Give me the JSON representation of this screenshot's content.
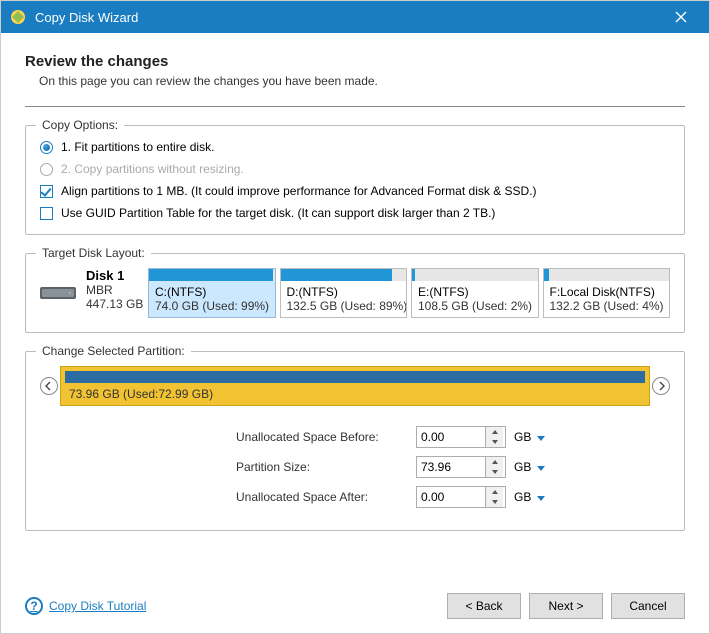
{
  "window": {
    "title": "Copy Disk Wizard"
  },
  "header": {
    "title": "Review the changes",
    "subtitle": "On this page you can review the changes you have been made."
  },
  "copy_options": {
    "legend": "Copy Options:",
    "opt1": "1. Fit partitions to entire disk.",
    "opt2": "2. Copy partitions without resizing.",
    "align": "Align partitions to 1 MB.  (It could improve performance for Advanced Format disk & SSD.)",
    "guid": "Use GUID Partition Table for the target disk. (It can support disk larger than 2 TB.)"
  },
  "layout": {
    "legend": "Target Disk Layout:",
    "disk": {
      "name": "Disk 1",
      "type": "MBR",
      "size": "447.13 GB"
    },
    "partitions": [
      {
        "label": "C:(NTFS)",
        "sub": "74.0 GB (Used: 99%)",
        "fill": 99,
        "selected": true
      },
      {
        "label": "D:(NTFS)",
        "sub": "132.5 GB (Used: 89%)",
        "fill": 89,
        "selected": false
      },
      {
        "label": "E:(NTFS)",
        "sub": "108.5 GB (Used: 2%)",
        "fill": 2,
        "selected": false
      },
      {
        "label": "F:Local Disk(NTFS)",
        "sub": "132.2 GB (Used: 4%)",
        "fill": 4,
        "selected": false
      }
    ]
  },
  "change": {
    "legend": "Change Selected Partition:",
    "bar_label": "73.96 GB (Used:72.99 GB)",
    "before_label": "Unallocated Space Before:",
    "size_label": "Partition Size:",
    "after_label": "Unallocated Space After:",
    "before_val": "0.00",
    "size_val": "73.96",
    "after_val": "0.00",
    "unit": "GB"
  },
  "footer": {
    "help": "Copy Disk Tutorial",
    "back": "< Back",
    "next": "Next >",
    "cancel": "Cancel"
  }
}
